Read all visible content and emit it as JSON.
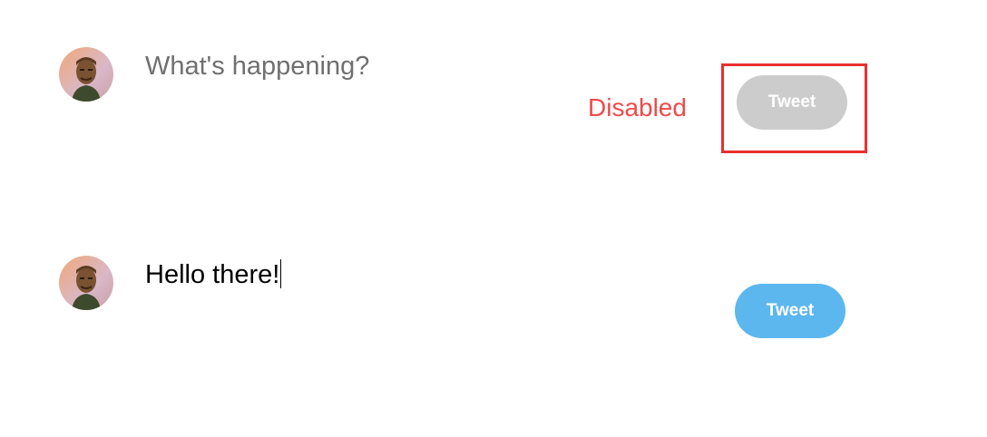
{
  "composer_disabled": {
    "avatar_icon": "user-avatar-icon",
    "placeholder": "What's happening?",
    "tweet_button_label": "Tweet",
    "button_state": "disabled",
    "annotation_label": "Disabled"
  },
  "composer_enabled": {
    "avatar_icon": "user-avatar-icon",
    "text_value": "Hello there!",
    "tweet_button_label": "Tweet",
    "button_state": "enabled"
  },
  "colors": {
    "disabled_button": "#cccccc",
    "enabled_button": "#5cb7ee",
    "annotation": "#f04a4a",
    "highlight_border": "#e8302f",
    "placeholder_text": "#707070"
  }
}
